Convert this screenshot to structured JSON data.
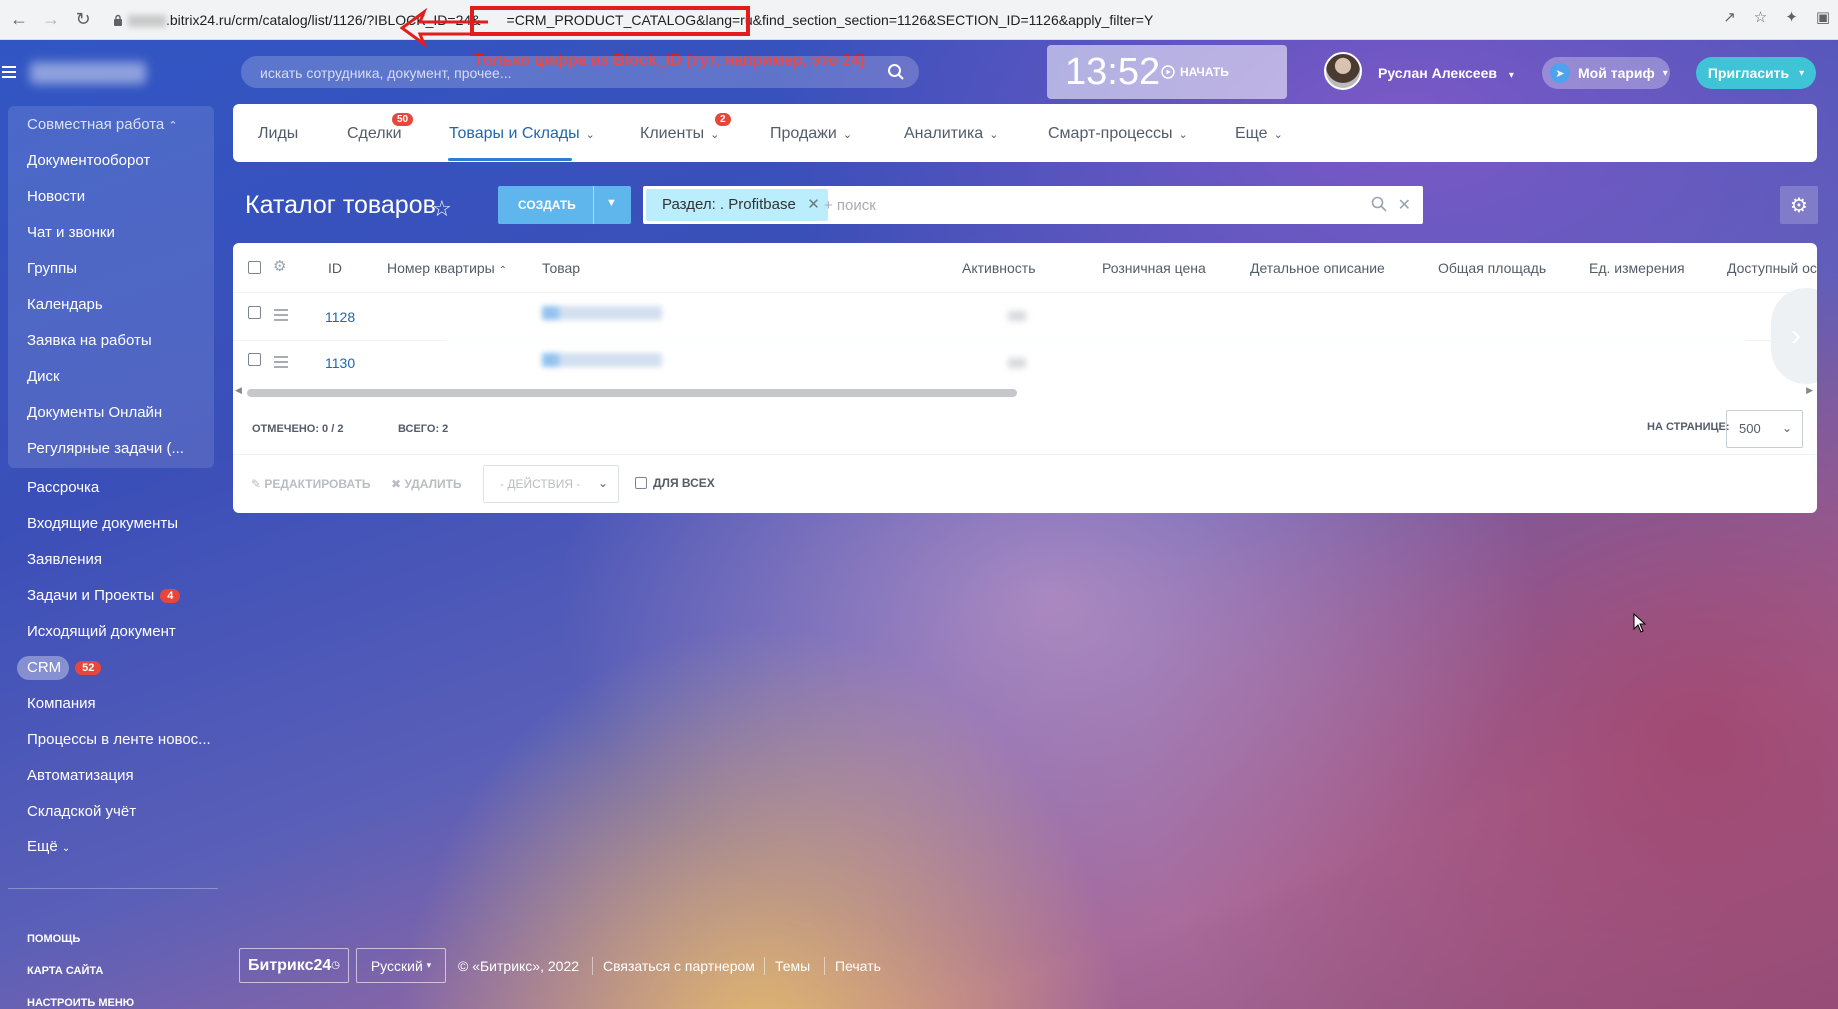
{
  "browser": {
    "url_prefix": ".bitrix24.ru/crm/catalog/list/1126/?IBLOCK_ID=24&",
    "url_rest": "=CRM_PRODUCT_CATALOG&lang=ru&find_section_section=1126&SECTION_ID=1126&apply_filter=Y"
  },
  "annotation": {
    "text": "Только цифра из Block_ID (тут, например, это 24)",
    "color": "#e31d1d"
  },
  "header": {
    "search_placeholder": "искать сотрудника, документ, прочее...",
    "clock_time": "13:52",
    "clock_start": "НАЧАТЬ",
    "user_name": "Руслан Алексеев",
    "tariff_label": "Мой тариф",
    "invite_label": "Пригласить"
  },
  "sidebar": {
    "group_title": "Совместная работа",
    "group_items": [
      "Документооборот",
      "Новости",
      "Чат и звонки",
      "Группы",
      "Календарь",
      "Заявка на работы",
      "Диск",
      "Документы Онлайн",
      "Регулярные задачи (..."
    ],
    "items": [
      "Рассрочка",
      "Входящие документы",
      "Заявления",
      "Задачи и Проекты",
      "Исходящий документ",
      "CRM",
      "Компания",
      "Процессы в ленте новос...",
      "Автоматизация",
      "Складской учёт",
      "Ещё"
    ],
    "tasks_badge": "4",
    "crm_badge": "52",
    "bottom_links": [
      "ПОМОЩЬ",
      "КАРТА САЙТА",
      "НАСТРОИТЬ МЕНЮ"
    ]
  },
  "nav": {
    "tabs": [
      "Лиды",
      "Сделки",
      "Товары и Склады",
      "Клиенты",
      "Продажи",
      "Аналитика",
      "Смарт-процессы",
      "Еще"
    ],
    "deals_badge": "50",
    "clients_badge": "2",
    "active_tab": "Товары и Склады"
  },
  "toolbar": {
    "title": "Каталог товаров",
    "create_label": "СОЗДАТЬ",
    "filter_chip": "Раздел: . Profitbase",
    "filter_placeholder": "+ поиск"
  },
  "grid": {
    "columns": [
      "ID",
      "Номер квартиры",
      "Товар",
      "Активность",
      "Розничная цена",
      "Детальное описание",
      "Общая площадь",
      "Ед. измерения",
      "Доступный ос"
    ],
    "rows": [
      {
        "id": "1128"
      },
      {
        "id": "1130"
      }
    ],
    "selected_label": "ОТМЕЧЕНО: 0 / 2",
    "total_label": "ВСЕГО: 2",
    "per_page_label": "НА СТРАНИЦЕ:",
    "per_page_value": "500",
    "edit_label": "РЕДАКТИРОВАТЬ",
    "delete_label": "УДАЛИТЬ",
    "actions_label": "- ДЕЙСТВИЯ -",
    "for_all_label": "ДЛЯ ВСЕХ"
  },
  "footer": {
    "logo": "Битрикс24",
    "language": "Русский",
    "copyright": "© «Битрикс», 2022",
    "links": [
      "Связаться с партнером",
      "Темы",
      "Печать"
    ]
  }
}
